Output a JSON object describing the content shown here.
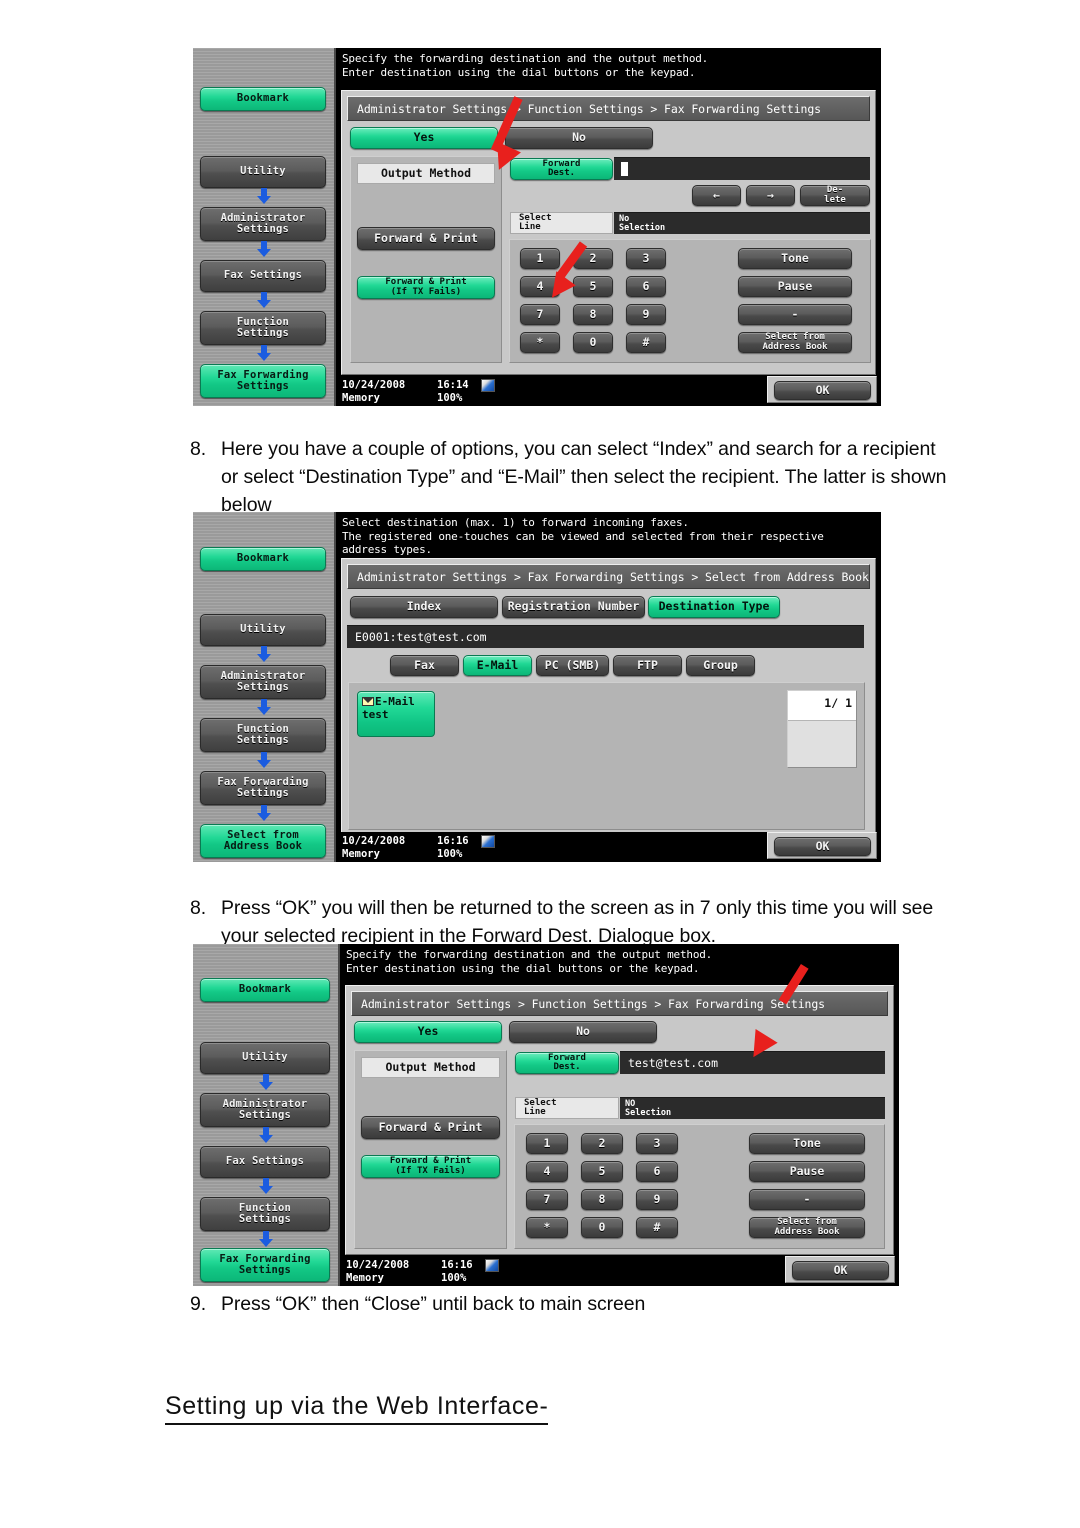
{
  "document": {
    "paragraphs": [
      {
        "number": "8.",
        "text": "Here you have a couple of options, you can select “Index” and search for a recipient or select “Destination Type” and “E-Mail” then select the recipient. The latter is shown below"
      },
      {
        "number": "8.",
        "text": "Press “OK” you will then be returned to the screen as in 7 only this time you will see your selected recipient in the Forward Dest. Dialogue box."
      },
      {
        "number": "9.",
        "text": "Press “OK” then “Close” until back to main screen"
      }
    ],
    "heading": "Setting up via the Web Interface-"
  },
  "colors": {
    "accent_green": "#13c886",
    "arrow_red": "#e8201d",
    "nav_arrow_blue": "#1b5ce0",
    "panel_bg": "#c8c8c8",
    "button_dark": "#5c5c5c",
    "field_dark": "#2b2b2b"
  },
  "panel1": {
    "message": "Specify the forwarding destination and the output method.\nEnter destination using the dial buttons or the keypad.",
    "breadcrumb": "Administrator Settings > Function Settings > Fax Forwarding Settings",
    "sidebar": {
      "bookmark": "Bookmark",
      "items": [
        {
          "label": "Utility",
          "active": false
        },
        {
          "label": "Administrator\nSettings",
          "active": false
        },
        {
          "label": "Fax Settings",
          "active": false
        },
        {
          "label": "Function\nSettings",
          "active": false
        },
        {
          "label": "Fax Forwarding\nSettings",
          "active": true
        }
      ]
    },
    "yes_label": "Yes",
    "no_label": "No",
    "output_method_label": "Output Method",
    "forward_print_label": "Forward & Print",
    "forward_print_tx_label": "Forward & Print\n(If TX Fails)",
    "forward_dest_label": "Forward\nDest.",
    "forward_dest_value": "",
    "left_arrow_label": "←",
    "right_arrow_label": "→",
    "delete_label": "De-\nlete",
    "select_line_label": "Select\nLine",
    "select_line_value": "No\nSelection",
    "keypad": [
      "1",
      "2",
      "3",
      "4",
      "5",
      "6",
      "7",
      "8",
      "9",
      "*",
      "0",
      "#"
    ],
    "tone_label": "Tone",
    "pause_label": "Pause",
    "dash_label": "-",
    "address_book_label": "Select from\nAddress Book",
    "status_date": "10/24/2008",
    "status_time": "16:14",
    "status_memory_label": "Memory",
    "status_memory_value": "100%",
    "ok_label": "OK"
  },
  "panel2": {
    "message": "Select destination (max. 1) to forward incoming faxes.\nThe registered one-touches can be viewed and selected from their respective\naddress types.",
    "breadcrumb": "Administrator Settings > Fax Forwarding Settings > Select from Address Book",
    "sidebar": {
      "bookmark": "Bookmark",
      "items": [
        {
          "label": "Utility",
          "active": false
        },
        {
          "label": "Administrator\nSettings",
          "active": false
        },
        {
          "label": "Function\nSettings",
          "active": false
        },
        {
          "label": "Fax Forwarding\nSettings",
          "active": false
        },
        {
          "label": "Select from\nAddress Book",
          "active": true
        }
      ]
    },
    "tabs": [
      {
        "label": "Index",
        "active": false
      },
      {
        "label": "Registration Number",
        "active": false
      },
      {
        "label": "Destination Type",
        "active": true
      }
    ],
    "address_field": "E0001:test@test.com",
    "types": [
      {
        "label": "Fax",
        "active": false
      },
      {
        "label": "E-Mail",
        "active": true
      },
      {
        "label": "PC (SMB)",
        "active": false
      },
      {
        "label": "FTP",
        "active": false
      },
      {
        "label": "Group",
        "active": false
      }
    ],
    "tile": {
      "type": "E-Mail",
      "name": "test"
    },
    "page_indicator": "1/  1",
    "status_date": "10/24/2008",
    "status_time": "16:16",
    "status_memory_label": "Memory",
    "status_memory_value": "100%",
    "ok_label": "OK"
  },
  "panel3": {
    "message": "Specify the forwarding destination and the output method.\nEnter destination using the dial buttons or the keypad.",
    "breadcrumb": "Administrator Settings > Function Settings > Fax Forwarding Settings",
    "sidebar": {
      "bookmark": "Bookmark",
      "items": [
        {
          "label": "Utility",
          "active": false
        },
        {
          "label": "Administrator\nSettings",
          "active": false
        },
        {
          "label": "Fax Settings",
          "active": false
        },
        {
          "label": "Function\nSettings",
          "active": false
        },
        {
          "label": "Fax Forwarding\nSettings",
          "active": true
        }
      ]
    },
    "yes_label": "Yes",
    "no_label": "No",
    "output_method_label": "Output Method",
    "forward_print_label": "Forward & Print",
    "forward_print_tx_label": "Forward & Print\n(If TX Fails)",
    "forward_dest_label": "Forward\nDest.",
    "forward_dest_value": "test@test.com",
    "select_line_label": "Select\nLine",
    "select_line_value": "NO\nSelection",
    "keypad": [
      "1",
      "2",
      "3",
      "4",
      "5",
      "6",
      "7",
      "8",
      "9",
      "*",
      "0",
      "#"
    ],
    "tone_label": "Tone",
    "pause_label": "Pause",
    "dash_label": "-",
    "address_book_label": "Select from\nAddress Book",
    "status_date": "10/24/2008",
    "status_time": "16:16",
    "status_memory_label": "Memory",
    "status_memory_value": "100%",
    "ok_label": "OK"
  }
}
